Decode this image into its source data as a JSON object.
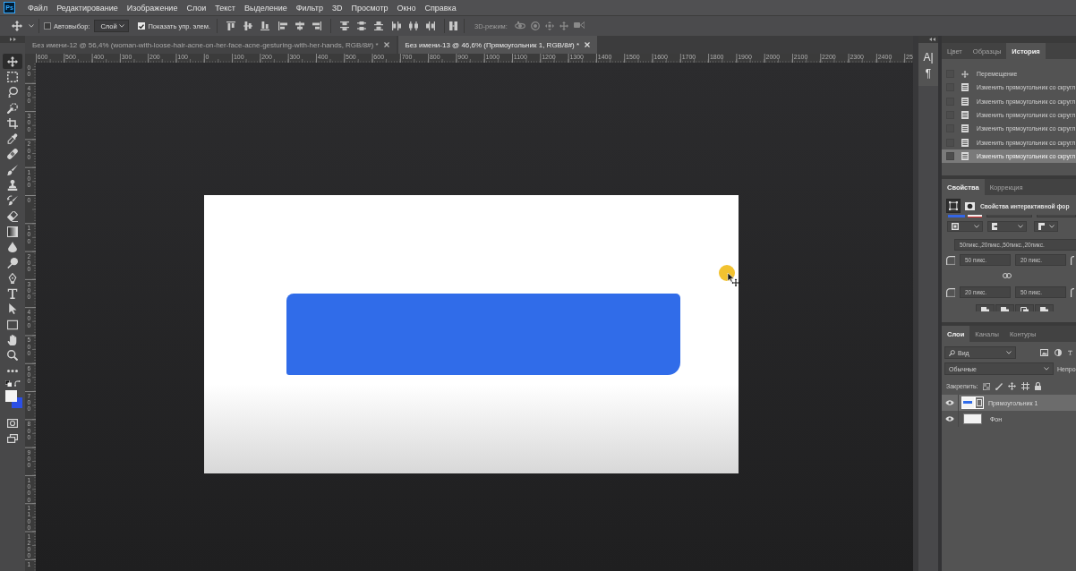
{
  "menu_bar": {
    "logo": "Ps",
    "items": [
      "Файл",
      "Редактирование",
      "Изображение",
      "Слои",
      "Текст",
      "Выделение",
      "Фильтр",
      "3D",
      "Просмотр",
      "Окно",
      "Справка"
    ]
  },
  "options_bar": {
    "auto_select": {
      "label": "Автовыбор:",
      "checked": false
    },
    "target": {
      "value": "Слой"
    },
    "show_controls": {
      "label": "Показать упр. элем.",
      "checked": true
    },
    "mode_3d": {
      "label": "3D-режим:",
      "disabled": true
    }
  },
  "toolbar": {
    "tools": [
      {
        "kind": "move",
        "selected": true
      },
      {
        "kind": "marquee",
        "selected": false
      },
      {
        "kind": "lasso",
        "selected": false
      },
      {
        "kind": "quick_select",
        "selected": false
      },
      {
        "kind": "crop",
        "selected": false
      },
      {
        "kind": "eyedropper",
        "selected": false
      },
      {
        "kind": "healing",
        "selected": false
      },
      {
        "kind": "brush",
        "selected": false
      },
      {
        "kind": "stamp",
        "selected": false
      },
      {
        "kind": "history_brush",
        "selected": false
      },
      {
        "kind": "eraser",
        "selected": false
      },
      {
        "kind": "gradient",
        "selected": false
      },
      {
        "kind": "blur",
        "selected": false
      },
      {
        "kind": "dodge",
        "selected": false
      },
      {
        "kind": "pen",
        "selected": false
      },
      {
        "kind": "type",
        "selected": false
      },
      {
        "kind": "path_select",
        "selected": false
      },
      {
        "kind": "shape",
        "selected": false
      },
      {
        "kind": "hand",
        "selected": false
      },
      {
        "kind": "zoom",
        "selected": false
      },
      {
        "kind": "more",
        "selected": false
      }
    ],
    "colors": [
      {
        "kind": "foreground",
        "color": "#f4f4f4"
      },
      {
        "kind": "background",
        "color": "#2b4fe6"
      }
    ]
  },
  "document_tabs": [
    {
      "title": "Без имени-12 @ 56,4% (woman-with-loose-hair-acne-on-her-face-acne-gesturing-with-her-hands, RGB/8#) *",
      "selected": false
    },
    {
      "title": "Без имени-13 @ 46,6% (Прямоугольник 1, RGB/8#) *",
      "selected": true
    }
  ],
  "horizontal_ruler": {
    "labels": [
      "600",
      "500",
      "400",
      "300",
      "200",
      "100",
      "0",
      "100",
      "200",
      "300",
      "400",
      "500",
      "600",
      "700",
      "800",
      "900",
      "1000",
      "1100",
      "1200",
      "1300",
      "1400",
      "1500",
      "1600",
      "1700",
      "1800",
      "1900",
      "2000",
      "2100",
      "2200",
      "2300",
      "2400",
      "25"
    ]
  },
  "vertical_ruler": {
    "labels": [
      "00",
      "400",
      "300",
      "200",
      "100",
      "0",
      "100",
      "200",
      "300",
      "400",
      "500",
      "600",
      "700",
      "800",
      "900",
      "1000",
      "1100",
      "1200",
      "1"
    ]
  },
  "side_strip": {
    "buttons": [
      "A|",
      "¶"
    ]
  },
  "history_panel": {
    "tabs": [
      {
        "label": "Цвет",
        "selected": false
      },
      {
        "label": "Образцы",
        "selected": false
      },
      {
        "label": "История",
        "selected": true
      }
    ],
    "steps": [
      {
        "kind": "move",
        "label": "Перемещение",
        "checked": false,
        "selected": false
      },
      {
        "kind": "edit",
        "label": "Изменить прямоугольник со скругл",
        "checked": false,
        "selected": false
      },
      {
        "kind": "edit",
        "label": "Изменить прямоугольник со скругл",
        "checked": false,
        "selected": false
      },
      {
        "kind": "edit",
        "label": "Изменить прямоугольник со скругл",
        "checked": false,
        "selected": false
      },
      {
        "kind": "edit",
        "label": "Изменить прямоугольник со скругл",
        "checked": false,
        "selected": false
      },
      {
        "kind": "edit",
        "label": "Изменить прямоугольник со скругл",
        "checked": false,
        "selected": false
      },
      {
        "kind": "edit",
        "label": "Изменить прямоугольник со скругл",
        "checked": false,
        "selected": true
      }
    ]
  },
  "properties_panel": {
    "tabs": [
      {
        "label": "Свойства",
        "selected": true
      },
      {
        "label": "Коррекция",
        "selected": false
      }
    ],
    "title": "Свойства интерактивной фор",
    "corner_radii": "50пикс.,20пикс.,50пикс.,20пикс.",
    "corner_rows": [
      {
        "fields": [
          "50 пикс.",
          "20 пикс."
        ]
      },
      {
        "fields": [
          "20 пикс.",
          "50 пикс."
        ]
      }
    ]
  },
  "layers_panel": {
    "tabs": [
      {
        "label": "Слои",
        "selected": true
      },
      {
        "label": "Каналы",
        "selected": false
      },
      {
        "label": "Контуры",
        "selected": false
      }
    ],
    "filter": {
      "value": "Вид"
    },
    "blend_mode": {
      "value": "Обычные"
    },
    "opacity_label": "Непро",
    "lock_label": "Закрепить:",
    "layers": [
      {
        "kind": "shape",
        "name": "Прямоугольник 1",
        "visible": true,
        "selected": true
      },
      {
        "kind": "background",
        "name": "Фон",
        "visible": true,
        "selected": false
      }
    ]
  }
}
